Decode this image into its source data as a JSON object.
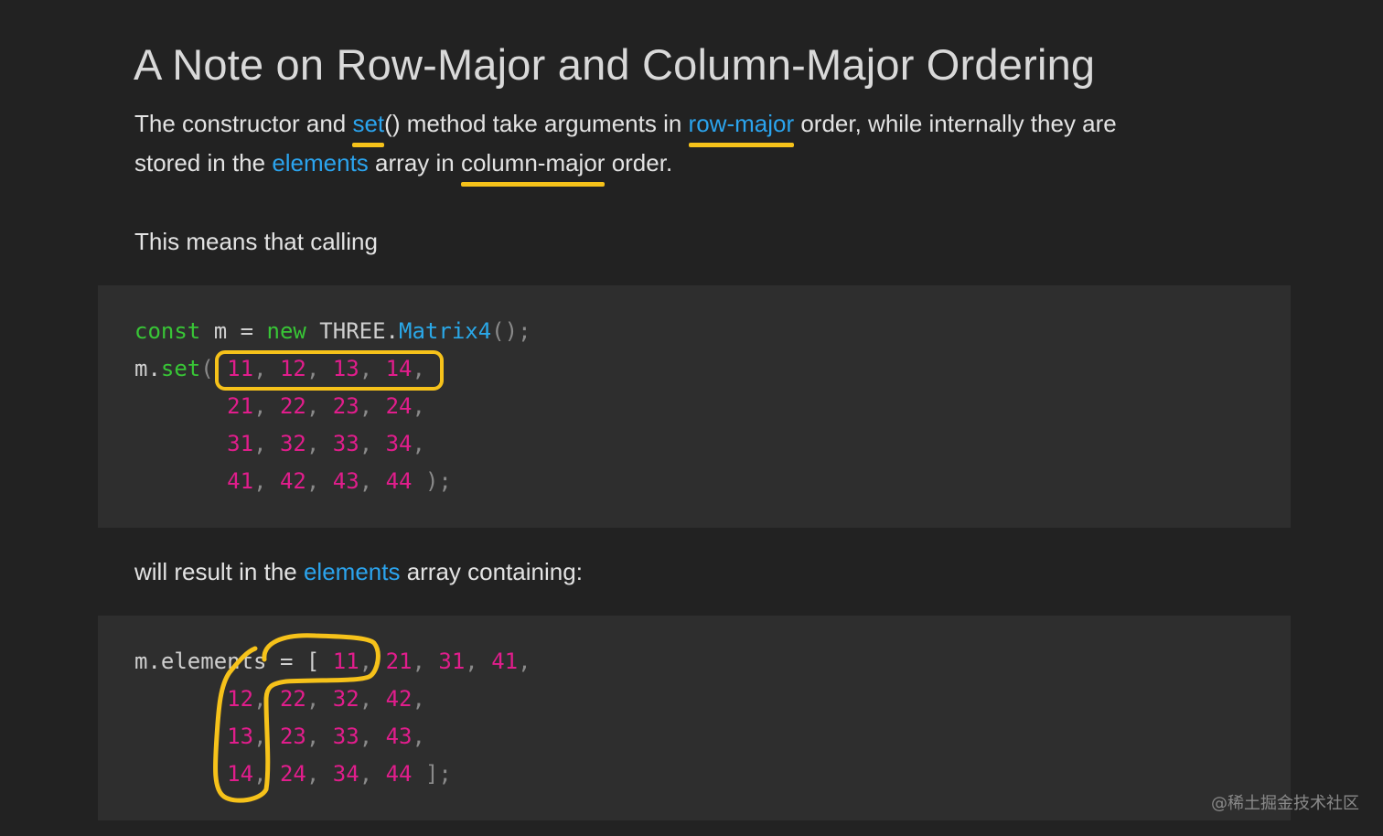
{
  "article": {
    "title": "A Note on Row-Major and Column-Major Ordering",
    "intro": {
      "t1": "The constructor and ",
      "set_link": "set",
      "t2": "() method take arguments in ",
      "row_major_link": "row-major",
      "t3": " order, while internally they are",
      "t4": "stored in the ",
      "elements_link": "elements",
      "t5": " array in ",
      "column_major": "column-major",
      "t6": " order."
    },
    "calling": "This means that calling",
    "result": {
      "t1": "will result in the ",
      "elements_link": "elements",
      "t2": " array containing:"
    }
  },
  "code1": {
    "line1": {
      "kw_const": "const",
      "var": " m = ",
      "kw_new": "new",
      "cls": " THREE.",
      "fn": "Matrix4",
      "end": "();"
    },
    "line2": {
      "obj": "m.",
      "method": "set",
      "open": "( ",
      "n1": "11",
      "n2": "12",
      "n3": "13",
      "n4": "14"
    },
    "rows": [
      [
        "21",
        "22",
        "23",
        "24"
      ],
      [
        "31",
        "32",
        "33",
        "34"
      ],
      [
        "41",
        "42",
        "43",
        "44"
      ]
    ],
    "close": " );"
  },
  "code2": {
    "prefix": "m.elements = [ ",
    "rows": [
      [
        "11",
        "21",
        "31",
        "41"
      ],
      [
        "12",
        "22",
        "32",
        "42"
      ],
      [
        "13",
        "23",
        "33",
        "43"
      ],
      [
        "14",
        "24",
        "34",
        "44"
      ]
    ],
    "close": " ];"
  },
  "watermark": "@稀土掘金技术社区",
  "colors": {
    "background": "#222222",
    "code_background": "#2e2e2e",
    "link": "#2ba4ee",
    "keyword": "#38c536",
    "number": "#e11d8c",
    "highlight": "#f6c21a"
  }
}
